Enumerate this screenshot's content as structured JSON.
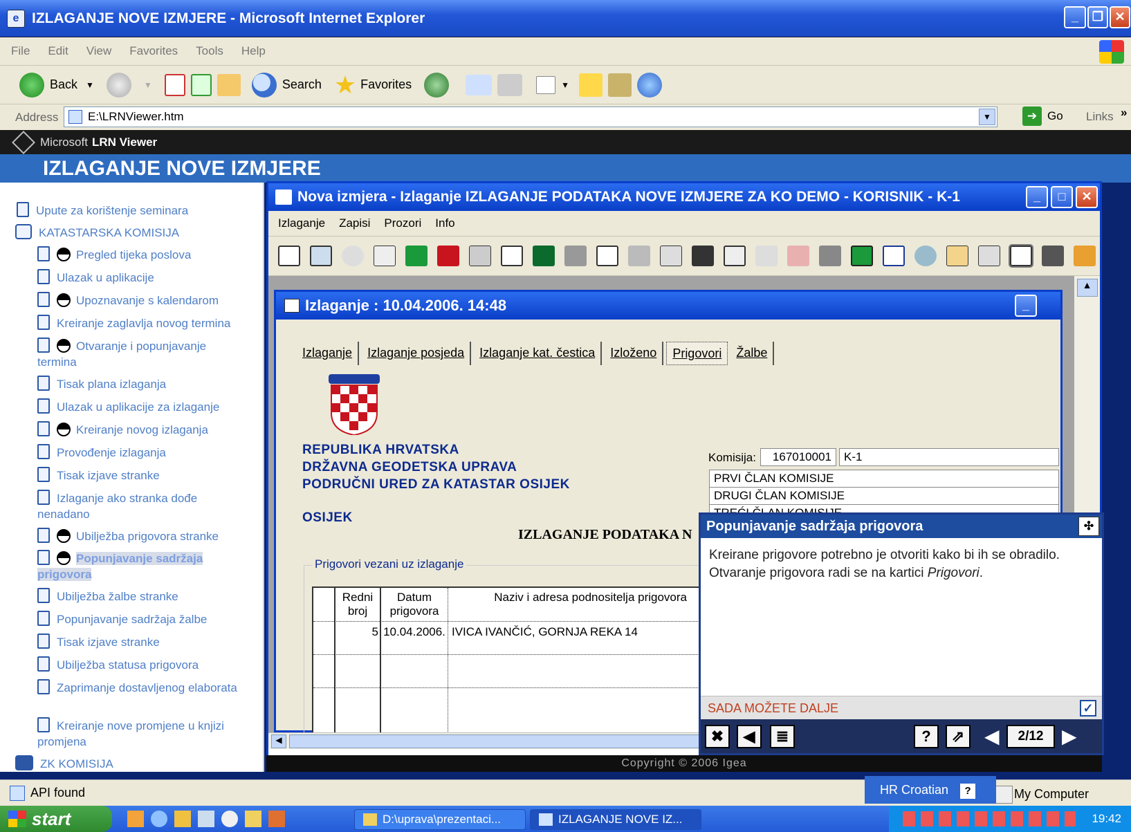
{
  "browser": {
    "title": "IZLAGANJE NOVE IZMJERE - Microsoft Internet Explorer",
    "menu": [
      "File",
      "Edit",
      "View",
      "Favorites",
      "Tools",
      "Help"
    ],
    "toolbar": {
      "back": "Back",
      "search": "Search",
      "favorites": "Favorites"
    },
    "address_label": "Address",
    "address_value": "E:\\LRNViewer.htm",
    "go": "Go",
    "links": "Links"
  },
  "viewer": {
    "brand_prefix": "Microsoft",
    "brand_name": "LRN Viewer"
  },
  "course_title": "IZLAGANJE NOVE IZMJERE",
  "nav": [
    {
      "label": "Upute za korištenje seminara",
      "icon": "doc"
    },
    {
      "label": "KATASTARSKA KOMISIJA",
      "icon": "book"
    },
    {
      "label": "Pregled tijeka poslova",
      "icon": "half"
    },
    {
      "label": "Ulazak u aplikacije",
      "icon": "doc"
    },
    {
      "label": "Upoznavanje s kalendarom",
      "icon": "half"
    },
    {
      "label": "Kreiranje zaglavlja novog termina",
      "icon": "doc"
    },
    {
      "label": "Otvaranje i popunjavanje termina",
      "icon": "half"
    },
    {
      "label": "Tisak plana izlaganja",
      "icon": "doc"
    },
    {
      "label": "Ulazak u aplikacije za izlaganje",
      "icon": "doc"
    },
    {
      "label": "Kreiranje novog izlaganja",
      "icon": "half"
    },
    {
      "label": "Provođenje izlaganja",
      "icon": "doc"
    },
    {
      "label": "Tisak izjave stranke",
      "icon": "doc"
    },
    {
      "label": "Izlaganje ako stranka dođe nenadano",
      "icon": "doc"
    },
    {
      "label": "Ubilježba prigovora stranke",
      "icon": "half"
    },
    {
      "label": "Popunjavanje sadržaja prigovora",
      "icon": "half"
    },
    {
      "label": "Ubilježba žalbe stranke",
      "icon": "doc"
    },
    {
      "label": "Popunjavanje sadržaja žalbe",
      "icon": "doc"
    },
    {
      "label": "Tisak izjave stranke",
      "icon": "doc"
    },
    {
      "label": "Ubilježba statusa prigovora",
      "icon": "doc"
    },
    {
      "label": "Zaprimanje dostavljenog elaborata",
      "icon": "doc"
    },
    {
      "label": "Kreiranje nove promjene u knjizi promjena",
      "icon": "doc"
    },
    {
      "label": "ZK KOMISIJA",
      "icon": "book"
    }
  ],
  "app": {
    "title": "Nova izmjera - Izlaganje IZLAGANJE PODATAKA NOVE IZMJERE ZA KO DEMO - KORISNIK - K-1",
    "menu": [
      "Izlaganje",
      "Zapisi",
      "Prozori",
      "Info"
    ],
    "child_title": "Izlaganje : 10.04.2006. 14:48",
    "tabs": [
      "Izlaganje",
      "Izlaganje posjeda",
      "Izlaganje kat. čestica",
      "Izloženo",
      "Prigovori",
      "Žalbe"
    ],
    "org_lines": [
      "REPUBLIKA HRVATSKA",
      "DRŽAVNA GEODETSKA UPRAVA",
      "PODRUČNI URED ZA KATASTAR OSIJEK"
    ],
    "city": "OSIJEK",
    "heading": "IZLAGANJE PODATAKA N",
    "komisija_label": "Komisija:",
    "komisija_code": "167010001",
    "komisija_id": "K-1",
    "members": [
      "PRVI ČLAN KOMISIJE",
      "DRUGI ČLAN KOMISIJE",
      "TREĆI ČLAN KOMISIJE"
    ],
    "fieldset_legend": "Prigovori vezani uz izlaganje",
    "grid": {
      "headers": [
        "Redni broj",
        "Datum prigovora",
        "Naziv i adresa podnositelja prigovora"
      ],
      "rows": [
        [
          "5",
          "10.04.2006.",
          "IVICA IVANČIĆ, GORNJA REKA 14"
        ]
      ]
    }
  },
  "copyright": "Copyright © 2006 Igea",
  "help": {
    "title": "Popunjavanje sadržaja prigovora",
    "body_1": "Kreirane prigovore potrebno je otvoriti kako bi ih se obradilo.",
    "body_2_prefix": "Otvaranje prigovora radi se na kartici ",
    "body_2_em": "Prigovori",
    "body_2_suffix": ".",
    "status": "SADA MOŽETE DALJE",
    "page": "2/12"
  },
  "statusbar": {
    "left": "API found",
    "language": "HR Croatian",
    "zone": "My Computer"
  },
  "taskbar": {
    "start": "start",
    "tasks": [
      "D:\\uprava\\prezentaci...",
      "IZLAGANJE NOVE IZ..."
    ],
    "clock": "19:42"
  }
}
